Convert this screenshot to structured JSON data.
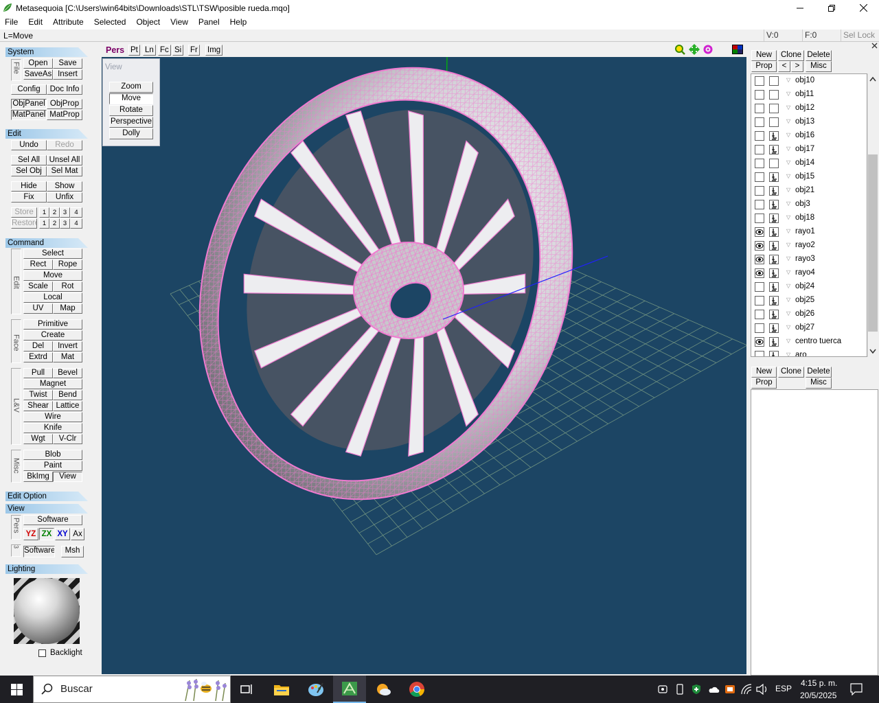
{
  "window": {
    "title": "Metasequoia [C:\\Users\\win64bits\\Downloads\\STL\\TSW\\posible rueda.mqo]"
  },
  "menu": [
    "File",
    "Edit",
    "Attribute",
    "Selected",
    "Object",
    "View",
    "Panel",
    "Help"
  ],
  "status": {
    "mode": "L=Move",
    "vertices": "V:0",
    "faces": "F:0",
    "sel_lock": "Sel Lock"
  },
  "left": {
    "system": {
      "header": "System",
      "file_label": "File",
      "open": "Open",
      "save": "Save",
      "saveas": "SaveAs",
      "insert": "Insert",
      "config": "Config",
      "docinfo": "Doc Info",
      "objpanel": "ObjPanel",
      "objprop": "ObjProp",
      "matpanel": "MatPanel",
      "matprop": "MatProp"
    },
    "edit": {
      "header": "Edit",
      "undo": "Undo",
      "redo": "Redo",
      "selall": "Sel All",
      "unselall": "Unsel All",
      "selobj": "Sel Obj",
      "selmat": "Sel Mat",
      "hide": "Hide",
      "show": "Show",
      "fix": "Fix",
      "unfix": "Unfix",
      "store": "Store",
      "restore": "Restore",
      "n1": "1",
      "n2": "2",
      "n3": "3",
      "n4": "4"
    },
    "command": {
      "header": "Command",
      "edit_label": "Edit",
      "face_label": "Face",
      "lv_label": "L&V",
      "misc_label": "Misc",
      "select": "Select",
      "rect": "Rect",
      "rope": "Rope",
      "move": "Move",
      "scale": "Scale",
      "rot": "Rot",
      "local": "Local",
      "uv": "UV",
      "map": "Map",
      "primitive": "Primitive",
      "create": "Create",
      "del": "Del",
      "invert": "Invert",
      "extrd": "Extrd",
      "mat": "Mat",
      "pull": "Pull",
      "bevel": "Bevel",
      "magnet": "Magnet",
      "twist": "Twist",
      "bend": "Bend",
      "shear": "Shear",
      "lattice": "Lattice",
      "wire": "Wire",
      "knife": "Knife",
      "wgt": "Wgt",
      "vclr": "V-Clr",
      "blob": "Blob",
      "paint": "Paint",
      "bkimg": "BkImg",
      "view": "View"
    },
    "edit_option": {
      "header": "Edit Option"
    },
    "view": {
      "header": "View",
      "pers_label": "Pers",
      "software": "Software",
      "yz": "YZ",
      "zx": "ZX",
      "xy": "XY",
      "ax": "Ax",
      "num3": "3",
      "software2": "Software",
      "msh": "Msh"
    },
    "lighting": {
      "header": "Lighting",
      "backlight": "Backlight"
    }
  },
  "viewport": {
    "tabs": [
      "Pers",
      "Pt",
      "Ln",
      "Fc",
      "Si",
      "Fr",
      "Img"
    ],
    "panel_title": "View",
    "buttons": [
      "Zoom",
      "Move",
      "Rotate",
      "Perspective",
      "Dolly"
    ],
    "active_button": "Move"
  },
  "right": {
    "obj_toolbar": {
      "new": "New",
      "clone": "Clone",
      "delete": "Delete",
      "prop": "Prop",
      "prev": "<",
      "next": ">",
      "misc": "Misc"
    },
    "objects": [
      {
        "name": "obj10",
        "visible": false,
        "locked": false
      },
      {
        "name": "obj11",
        "visible": false,
        "locked": false
      },
      {
        "name": "obj12",
        "visible": false,
        "locked": false
      },
      {
        "name": "obj13",
        "visible": false,
        "locked": false
      },
      {
        "name": "obj16",
        "visible": false,
        "locked": true
      },
      {
        "name": "obj17",
        "visible": false,
        "locked": true
      },
      {
        "name": "obj14",
        "visible": false,
        "locked": false
      },
      {
        "name": "obj15",
        "visible": false,
        "locked": true
      },
      {
        "name": "obj21",
        "visible": false,
        "locked": true
      },
      {
        "name": "obj3",
        "visible": false,
        "locked": true
      },
      {
        "name": "obj18",
        "visible": false,
        "locked": true
      },
      {
        "name": "rayo1",
        "visible": true,
        "locked": true
      },
      {
        "name": "rayo2",
        "visible": true,
        "locked": true
      },
      {
        "name": "rayo3",
        "visible": true,
        "locked": true
      },
      {
        "name": "rayo4",
        "visible": true,
        "locked": true
      },
      {
        "name": "obj24",
        "visible": false,
        "locked": true
      },
      {
        "name": "obj25",
        "visible": false,
        "locked": true
      },
      {
        "name": "obj26",
        "visible": false,
        "locked": true
      },
      {
        "name": "obj27",
        "visible": false,
        "locked": true
      },
      {
        "name": "centro tuerca",
        "visible": true,
        "locked": true
      },
      {
        "name": "aro",
        "visible": false,
        "locked": true
      }
    ],
    "mat_toolbar": {
      "new": "New",
      "clone": "Clone",
      "delete": "Delete",
      "prop": "Prop",
      "misc": "Misc"
    }
  },
  "taskbar": {
    "search_placeholder": "Buscar",
    "language": "ESP",
    "time": "4:15 p. m.",
    "date": "20/5/2025"
  },
  "colors": {
    "viewport_bg": "#1c4564",
    "wire": "#f07ad0",
    "grid": "#7a9a86",
    "axis_y": "#00c000",
    "axis_x": "#2020ff"
  }
}
